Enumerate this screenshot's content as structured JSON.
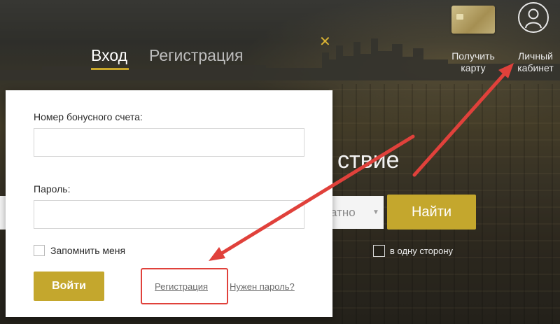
{
  "header": {
    "get_card_label": "Получить карту",
    "cabinet_label": "Личный кабинет"
  },
  "tabs": [
    {
      "label": "Вход",
      "active": true
    },
    {
      "label": "Регистрация",
      "active": false
    }
  ],
  "background": {
    "title_fragment": "ствие",
    "select_fragment": "атно",
    "find_button": "Найти",
    "oneway_label": "в одну сторону"
  },
  "login": {
    "bonus_label": "Номер бонусного счета:",
    "bonus_value": "",
    "password_label": "Пароль:",
    "password_value": "",
    "remember_label": "Запомнить меня",
    "submit_label": "Войти",
    "register_link": "Регистрация",
    "need_password_link": "Нужен пароль?"
  },
  "icons": {
    "close": "close-icon",
    "avatar": "user-avatar-icon",
    "card": "bonus-card-icon",
    "caret": "caret-down-icon"
  },
  "colors": {
    "accent": "#c4a72d",
    "annotation": "#e0413b"
  }
}
